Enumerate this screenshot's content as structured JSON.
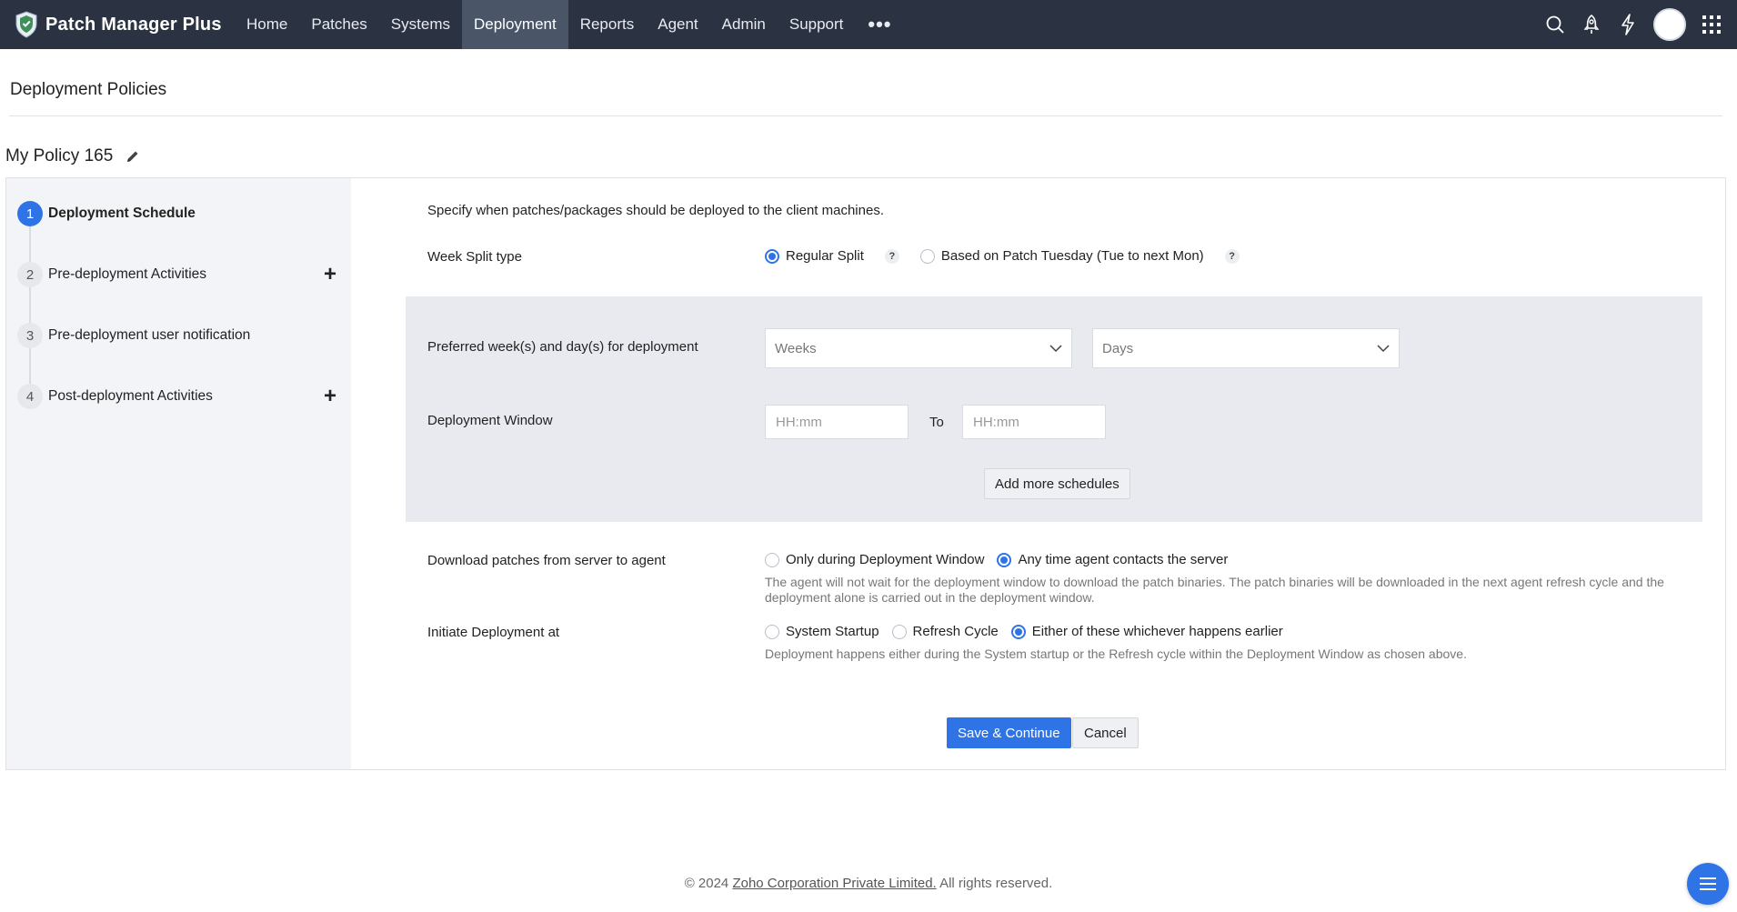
{
  "app": {
    "name": "Patch Manager Plus"
  },
  "nav": {
    "items": [
      {
        "label": "Home"
      },
      {
        "label": "Patches"
      },
      {
        "label": "Systems"
      },
      {
        "label": "Deployment"
      },
      {
        "label": "Reports"
      },
      {
        "label": "Agent"
      },
      {
        "label": "Admin"
      },
      {
        "label": "Support"
      }
    ],
    "more": "•••",
    "active": "Deployment"
  },
  "header": {
    "page_title": "Deployment Policies",
    "policy_name": "My Policy 165"
  },
  "steps": [
    {
      "num": "1",
      "label": "Deployment Schedule",
      "active": true
    },
    {
      "num": "2",
      "label": "Pre-deployment Activities",
      "expandable": true
    },
    {
      "num": "3",
      "label": "Pre-deployment user notification"
    },
    {
      "num": "4",
      "label": "Post-deployment Activities",
      "expandable": true
    }
  ],
  "form": {
    "intro": "Specify when patches/packages should be deployed to the client machines.",
    "week_split": {
      "label": "Week Split type",
      "options": [
        "Regular Split",
        "Based on Patch Tuesday (Tue to next Mon)"
      ],
      "selected": "Regular Split",
      "help": "?"
    },
    "preferred": {
      "label": "Preferred week(s) and day(s) for deployment",
      "weeks_placeholder": "Weeks",
      "days_placeholder": "Days"
    },
    "window": {
      "label": "Deployment Window",
      "from_placeholder": "HH:mm",
      "to_label": "To",
      "to_placeholder": "HH:mm"
    },
    "add_more": "Add more schedules",
    "download": {
      "label": "Download patches from server to agent",
      "options": [
        "Only during Deployment Window",
        "Any time agent contacts the server"
      ],
      "selected": "Any time agent contacts the server",
      "hint": "The agent will not wait for the deployment window to download the patch binaries. The patch binaries will be downloaded in the next agent refresh cycle and the deployment alone is carried out in the deployment window."
    },
    "initiate": {
      "label": "Initiate Deployment at",
      "options": [
        "System Startup",
        "Refresh Cycle",
        "Either of these whichever happens earlier"
      ],
      "selected": "Either of these whichever happens earlier",
      "hint": "Deployment happens either during the System startup or the Refresh cycle within the Deployment Window as chosen above."
    },
    "buttons": {
      "save": "Save & Continue",
      "cancel": "Cancel"
    }
  },
  "footer": {
    "prefix": "© 2024 ",
    "link": "Zoho Corporation Private Limited.",
    "suffix": " All rights reserved."
  },
  "colors": {
    "topbar": "#2b3342",
    "accent": "#2f74e6",
    "sidebar": "#f3f4f7",
    "block": "#e8eaef"
  },
  "icons": [
    "shield-logo-icon",
    "search-icon",
    "rocket-icon",
    "lightning-icon",
    "avatar",
    "apps-grid-icon",
    "edit-pencil-icon",
    "plus-icon",
    "chevron-down-icon",
    "menu-icon"
  ]
}
